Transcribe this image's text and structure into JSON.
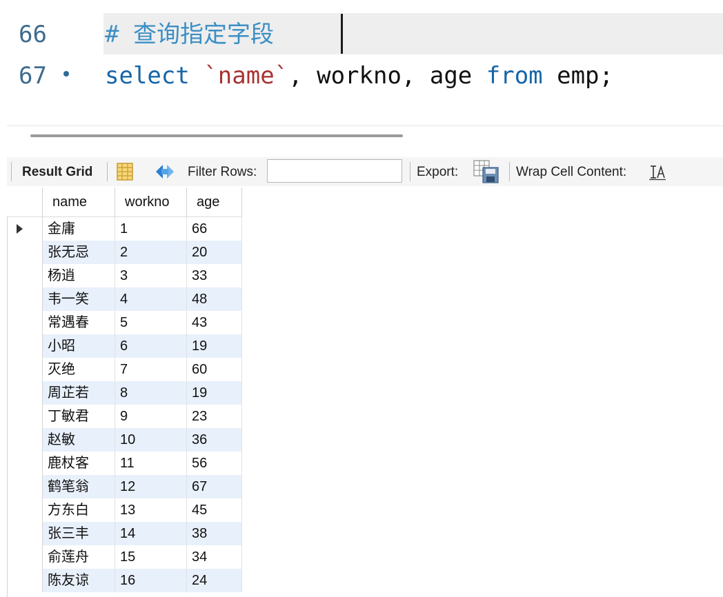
{
  "editor": {
    "lines": [
      {
        "number": "66",
        "comment": "# 查询指定字段"
      },
      {
        "number": "67",
        "kw_select": "select",
        "tick_open": "`",
        "ident": "name",
        "tick_close": "`",
        "rest1": ", workno, age ",
        "kw_from": "from",
        "rest2": " emp;"
      }
    ]
  },
  "toolbar": {
    "result_grid_label": "Result Grid",
    "filter_label": "Filter Rows:",
    "filter_value": "",
    "export_label": "Export:",
    "wrap_label": "Wrap Cell Content:"
  },
  "grid": {
    "columns": [
      "name",
      "workno",
      "age"
    ],
    "rows": [
      [
        "金庸",
        "1",
        "66"
      ],
      [
        "张无忌",
        "2",
        "20"
      ],
      [
        "杨逍",
        "3",
        "33"
      ],
      [
        "韦一笑",
        "4",
        "48"
      ],
      [
        "常遇春",
        "5",
        "43"
      ],
      [
        "小昭",
        "6",
        "19"
      ],
      [
        "灭绝",
        "7",
        "60"
      ],
      [
        "周芷若",
        "8",
        "19"
      ],
      [
        "丁敏君",
        "9",
        "23"
      ],
      [
        "赵敏",
        "10",
        "36"
      ],
      [
        "鹿杖客",
        "11",
        "56"
      ],
      [
        "鹤笔翁",
        "12",
        "67"
      ],
      [
        "方东白",
        "13",
        "45"
      ],
      [
        "张三丰",
        "14",
        "38"
      ],
      [
        "俞莲舟",
        "15",
        "34"
      ],
      [
        "陈友谅",
        "16",
        "24"
      ]
    ]
  },
  "colors": {
    "keyword": "#1565a8",
    "comment": "#3b8fc4",
    "string": "#a83232",
    "row_stripe": "#e8f0fb"
  },
  "icons": [
    "grid-layout-icon",
    "refresh-icon",
    "export-icon",
    "wrap-cell-icon",
    "current-row-arrow-icon"
  ]
}
